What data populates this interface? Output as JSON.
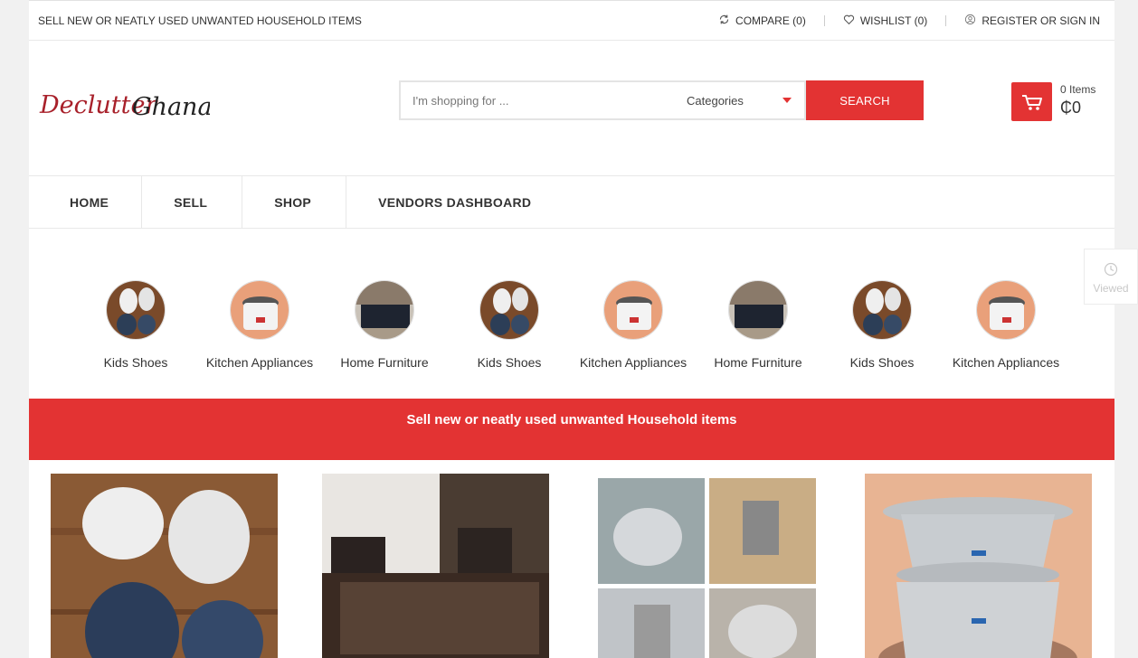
{
  "topbar": {
    "tagline": "SELL NEW OR NEATLY USED UNWANTED HOUSEHOLD ITEMS",
    "compare": "COMPARE (0)",
    "wishlist": "WISHLIST (0)",
    "account": "REGISTER OR SIGN IN"
  },
  "logo": {
    "text1": "Declutter",
    "text2": "Ghana"
  },
  "search": {
    "placeholder": "I'm shopping for ...",
    "category": "Categories",
    "button": "SEARCH"
  },
  "cart": {
    "count": "0 Items",
    "total": "₵0"
  },
  "nav": [
    "HOME",
    "SELL",
    "SHOP",
    "VENDORS DASHBOARD"
  ],
  "categories": [
    {
      "label": "Kids Shoes",
      "icon": "shoes"
    },
    {
      "label": "Kitchen Appliances",
      "icon": "cooker"
    },
    {
      "label": "Home Furniture",
      "icon": "furniture"
    },
    {
      "label": "Kids Shoes",
      "icon": "shoes"
    },
    {
      "label": "Kitchen Appliances",
      "icon": "cooker"
    },
    {
      "label": "Home Furniture",
      "icon": "furniture"
    },
    {
      "label": "Kids Shoes",
      "icon": "shoes"
    },
    {
      "label": "Kitchen Appliances",
      "icon": "cooker"
    }
  ],
  "banner": "Sell new or neatly used unwanted Household items",
  "viewed": "Viewed",
  "colors": {
    "accent": "#e33333",
    "logo": "#a8202a"
  }
}
